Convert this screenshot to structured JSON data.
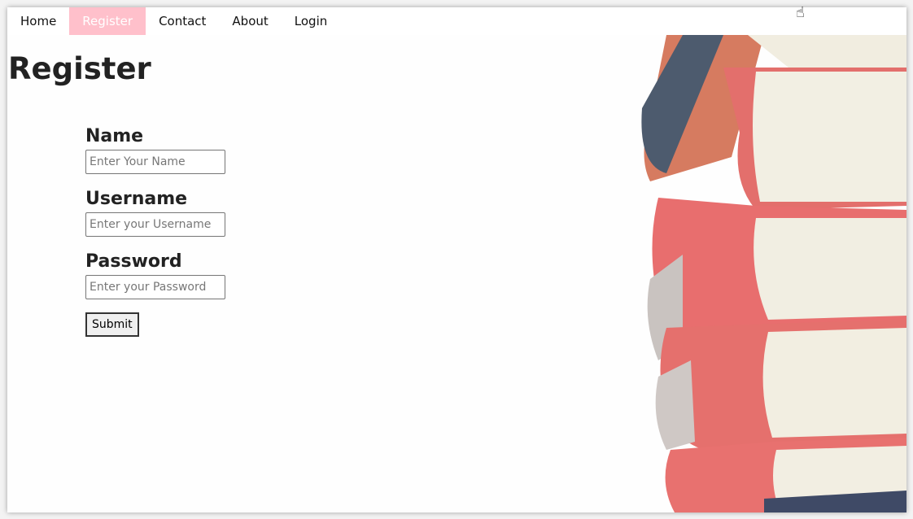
{
  "nav": {
    "items": [
      {
        "label": "Home",
        "active": false
      },
      {
        "label": "Register",
        "active": true
      },
      {
        "label": "Contact",
        "active": false
      },
      {
        "label": "About",
        "active": false
      },
      {
        "label": "Login",
        "active": false
      }
    ],
    "active_color": "#ffc0cb"
  },
  "page": {
    "title": "Register"
  },
  "form": {
    "name_label": "Name",
    "name_placeholder": "Enter Your Name",
    "username_label": "Username",
    "username_placeholder": "Enter your Username",
    "password_label": "Password",
    "password_placeholder": "Enter your Password",
    "submit_label": "Submit"
  },
  "image": {
    "subject": "stack-of-books"
  },
  "cursor": {
    "icon": "hand-pointer-icon"
  }
}
